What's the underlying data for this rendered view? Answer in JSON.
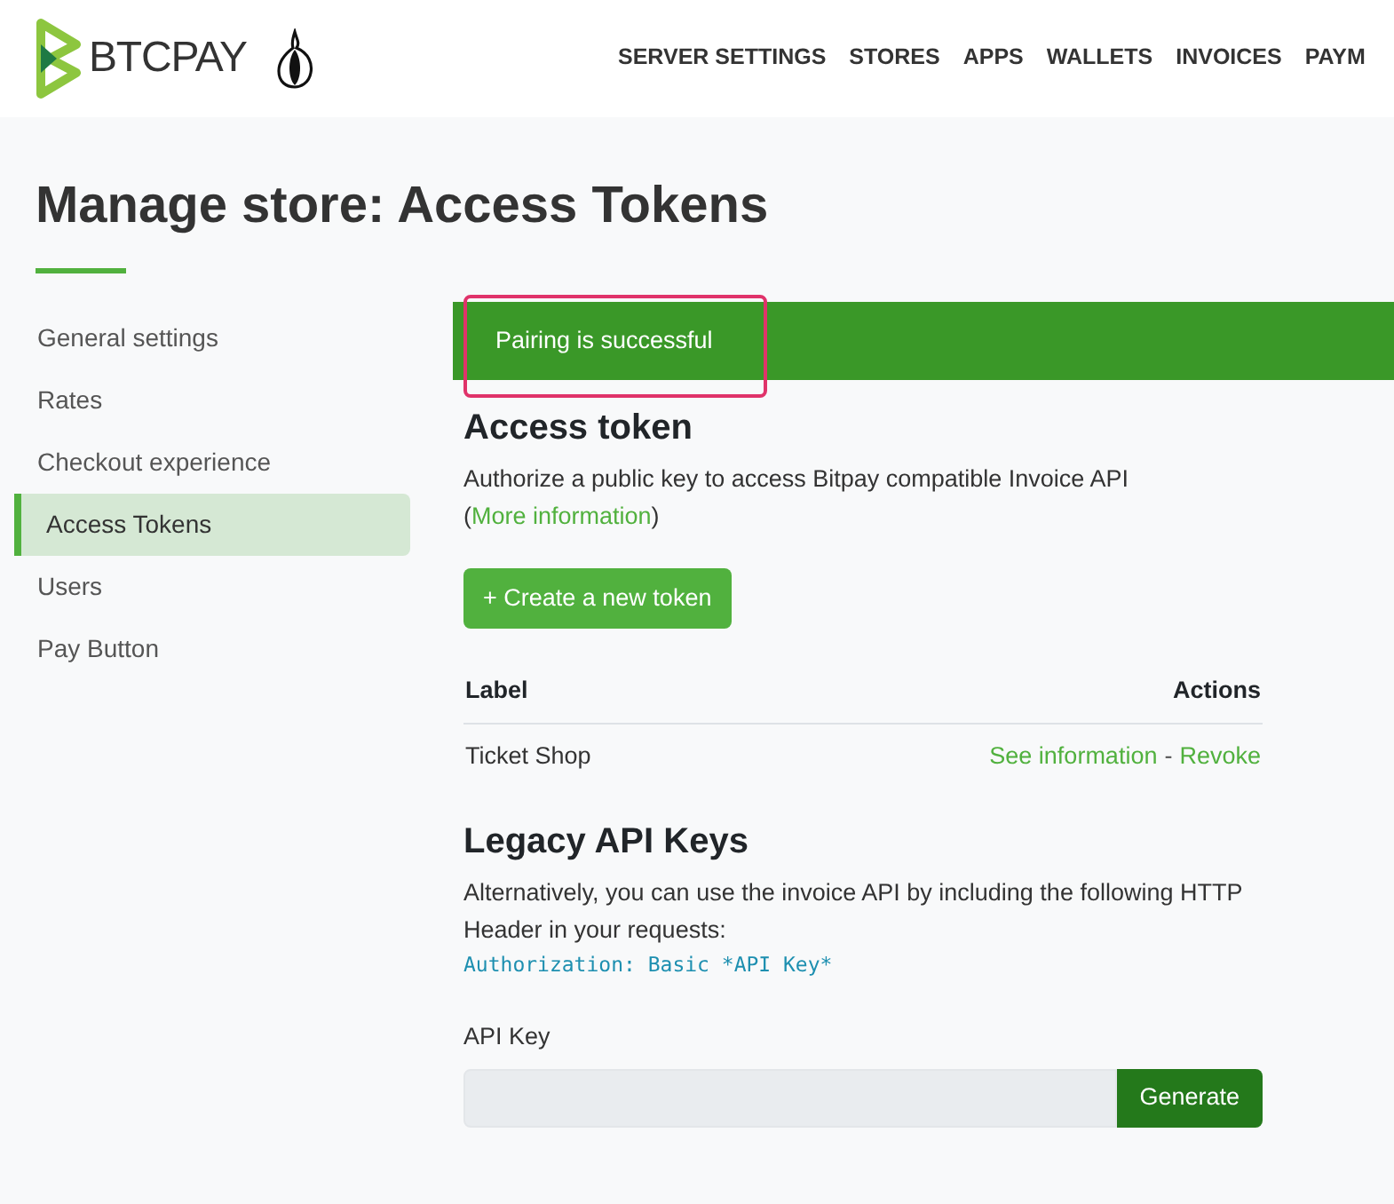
{
  "header": {
    "logo_text": "BTCPAY",
    "nav": [
      {
        "label": "SERVER SETTINGS"
      },
      {
        "label": "STORES"
      },
      {
        "label": "APPS"
      },
      {
        "label": "WALLETS"
      },
      {
        "label": "INVOICES"
      },
      {
        "label": "PAYM"
      }
    ]
  },
  "page_title": "Manage store: Access Tokens",
  "sidebar": {
    "items": [
      {
        "label": "General settings",
        "selected": false
      },
      {
        "label": "Rates",
        "selected": false
      },
      {
        "label": "Checkout experience",
        "selected": false
      },
      {
        "label": "Access Tokens",
        "selected": true
      },
      {
        "label": "Users",
        "selected": false
      },
      {
        "label": "Pay Button",
        "selected": false
      }
    ]
  },
  "alert": {
    "text": "Pairing is successful",
    "highlighted": true
  },
  "access_token": {
    "heading": "Access token",
    "description": "Authorize a public key to access Bitpay compatible Invoice API (",
    "link": "More information",
    "description_end": ")",
    "create_button": "+ Create a new token",
    "table": {
      "columns": [
        "Label",
        "Actions"
      ],
      "rows": [
        {
          "label": "Ticket Shop",
          "actions": [
            "See information",
            "Revoke"
          ],
          "separator": "-"
        }
      ]
    }
  },
  "legacy": {
    "heading": "Legacy API Keys",
    "description": "Alternatively, you can use the invoice API by including the following HTTP Header in your requests:",
    "code": "Authorization: Basic *API Key*",
    "field_label": "API Key",
    "button": "Generate"
  }
}
